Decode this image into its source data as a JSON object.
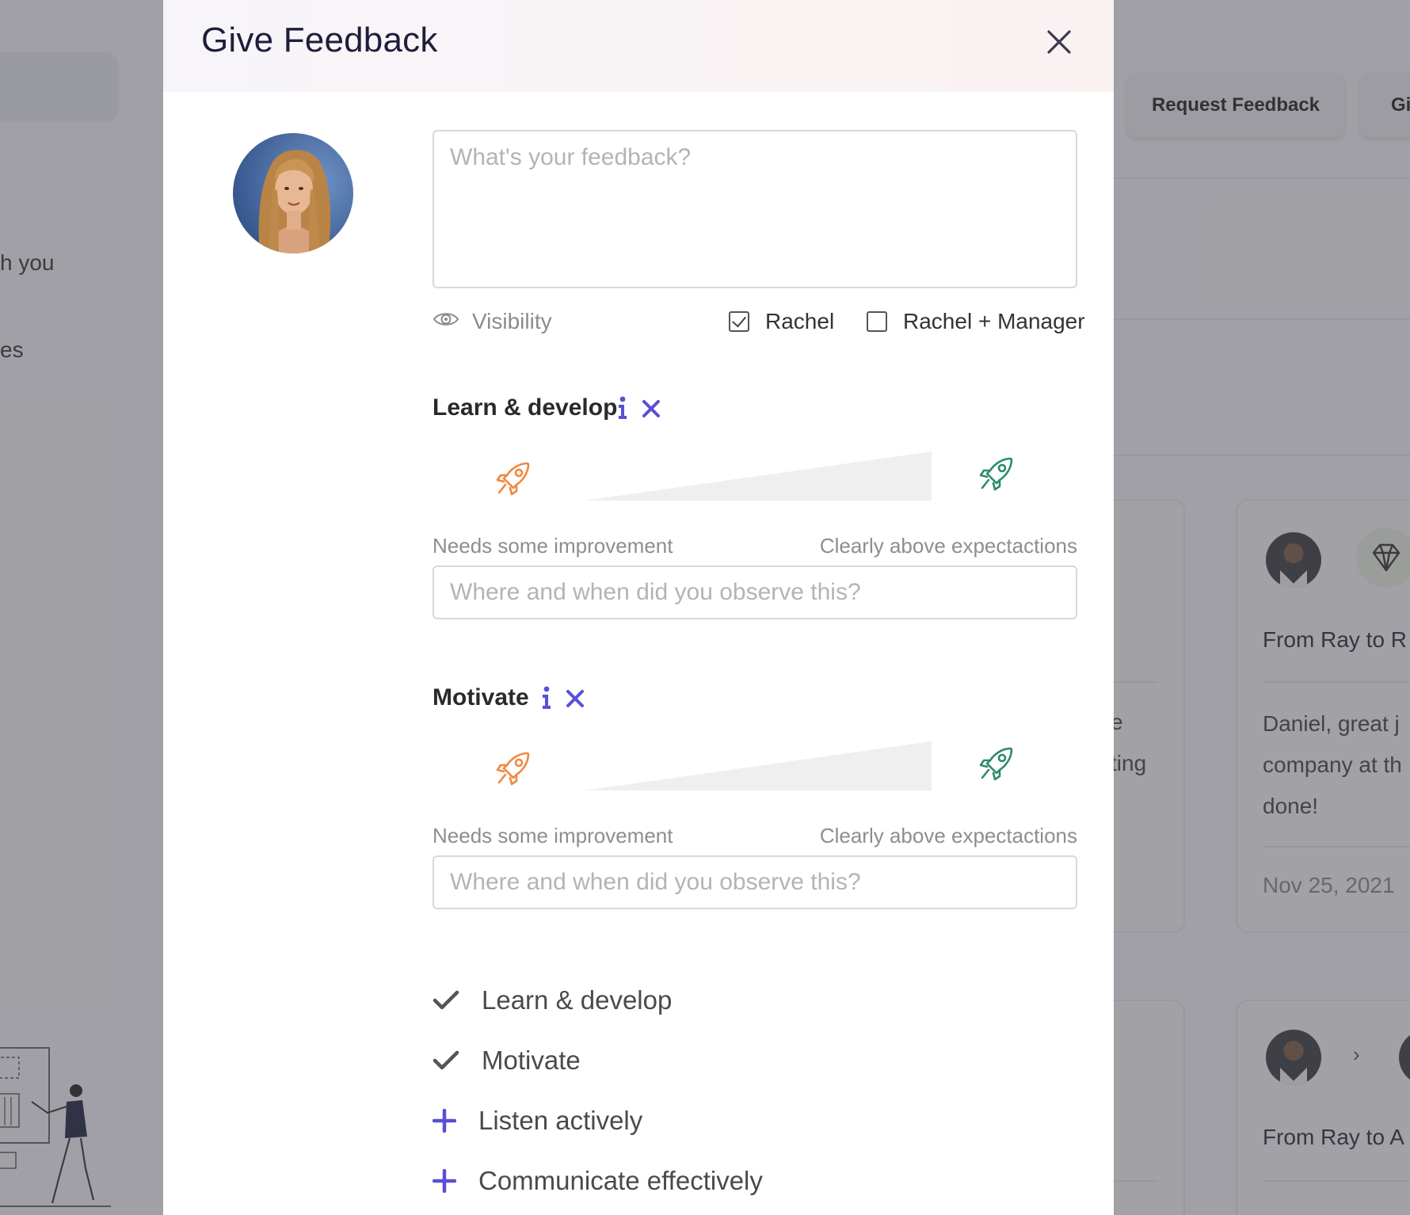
{
  "background": {
    "left_fragments": [
      "h you",
      "es"
    ],
    "buttons": {
      "request_feedback": "Request Feedback",
      "give_partial": "Gi"
    },
    "cards": [
      {
        "body_partial": [
          "e",
          "ting"
        ]
      },
      {
        "title": "From Ray to R",
        "body_lines": [
          "Daniel, great j",
          "company at th",
          "done!"
        ],
        "date": "Nov 25, 2021"
      },
      {
        "title": "From Ray to A",
        "chevron": "›"
      }
    ]
  },
  "modal": {
    "title": "Give Feedback",
    "close_icon": "close-icon",
    "feedback_placeholder": "What's your feedback?",
    "visibility": {
      "label": "Visibility",
      "options": [
        {
          "label": "Rachel",
          "checked": true
        },
        {
          "label": "Rachel + Manager",
          "checked": false
        }
      ]
    },
    "sections": [
      {
        "title": "Learn & develop",
        "scale_low": "Needs some improvement",
        "scale_high": "Clearly above expectactions",
        "observe_placeholder": "Where and when did you observe this?"
      },
      {
        "title": "Motivate",
        "scale_low": "Needs some improvement",
        "scale_high": "Clearly above expectactions",
        "observe_placeholder": "Where and when did you observe this?"
      }
    ],
    "competencies": [
      {
        "label": "Learn & develop",
        "state": "selected",
        "icon": "check-icon"
      },
      {
        "label": "Motivate",
        "state": "selected",
        "icon": "check-icon"
      },
      {
        "label": "Listen actively",
        "state": "available",
        "icon": "plus-icon"
      },
      {
        "label": "Communicate effectively",
        "state": "available",
        "icon": "plus-icon"
      }
    ],
    "colors": {
      "accent": "#5b4fd6",
      "rocket_low": "#f0883e",
      "rocket_high": "#2e8a70",
      "title": "#1f1e3a"
    }
  }
}
